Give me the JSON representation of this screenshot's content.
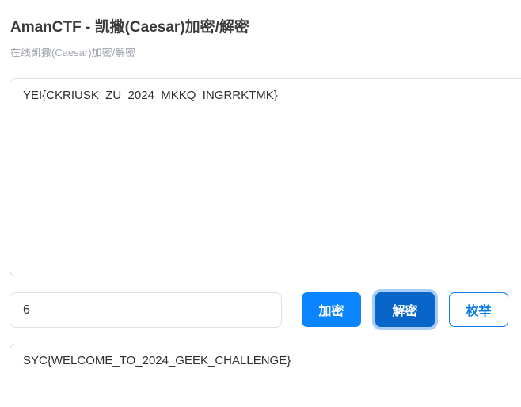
{
  "header": {
    "title": "AmanCTF - 凯撒(Caesar)加密/解密",
    "subtitle": "在线凯撒(Caesar)加密/解密"
  },
  "input": {
    "text": "YEI{CKRIUSK_ZU_2024_MKKQ_INGRRKTMK}"
  },
  "controls": {
    "shift_value": "6",
    "encrypt_label": "加密",
    "decrypt_label": "解密",
    "brute_label": "枚举"
  },
  "output": {
    "text": "SYC{WELCOME_TO_2024_GEEK_CHALLENGE}"
  },
  "colors": {
    "primary": "#0a84ff",
    "primary_active": "#0866c9",
    "focus_ring": "#a9cdf5",
    "outline_button": "#0a7de8",
    "border": "#dcdfe6"
  }
}
